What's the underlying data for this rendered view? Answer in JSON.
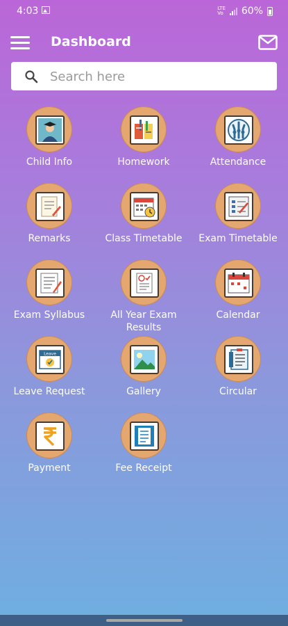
{
  "status_bar": {
    "time": "4:03",
    "network_line1": "LTE",
    "network_line2": "Vo",
    "battery": "60%"
  },
  "header": {
    "title": "Dashboard"
  },
  "search": {
    "placeholder": "Search here",
    "value": ""
  },
  "tiles": [
    {
      "label": "Child Info",
      "icon": "child-info-icon"
    },
    {
      "label": "Homework",
      "icon": "homework-icon"
    },
    {
      "label": "Attendance",
      "icon": "attendance-icon"
    },
    {
      "label": "Remarks",
      "icon": "remarks-icon"
    },
    {
      "label": "Class Timetable",
      "icon": "class-timetable-icon"
    },
    {
      "label": "Exam Timetable",
      "icon": "exam-timetable-icon"
    },
    {
      "label": "Exam Syllabus",
      "icon": "exam-syllabus-icon"
    },
    {
      "label": "All Year Exam Results",
      "icon": "exam-results-icon"
    },
    {
      "label": "Calendar",
      "icon": "calendar-icon"
    },
    {
      "label": "Leave Request",
      "icon": "leave-request-icon"
    },
    {
      "label": "Gallery",
      "icon": "gallery-icon"
    },
    {
      "label": "Circular",
      "icon": "circular-icon"
    },
    {
      "label": "Payment",
      "icon": "payment-icon"
    },
    {
      "label": "Fee Receipt",
      "icon": "fee-receipt-icon"
    }
  ],
  "leave_request_icon_text": "Leave",
  "colors": {
    "gradient_top": "#bb66d8",
    "gradient_bottom": "#6eafe0",
    "tile_circle": "#e3a76f",
    "bottom_bar": "#3e5f86"
  }
}
